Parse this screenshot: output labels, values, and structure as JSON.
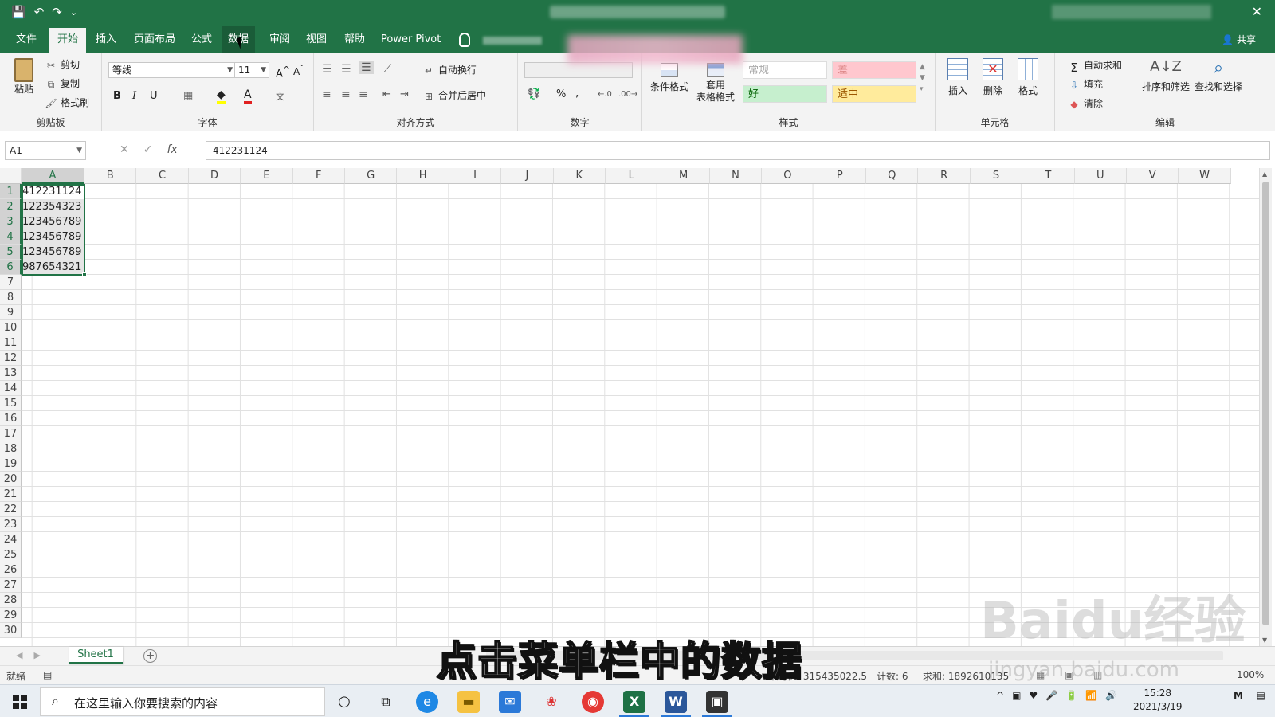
{
  "app": {
    "qat": [
      "💾",
      "↶",
      "↷",
      "⌄"
    ],
    "close_icon": "✕"
  },
  "menu": {
    "tabs": [
      "文件",
      "开始",
      "插入",
      "页面布局",
      "公式",
      "数据",
      "审阅",
      "视图",
      "帮助",
      "Power Pivot"
    ],
    "share": "共享"
  },
  "ribbon": {
    "clipboard": {
      "label": "剪贴板",
      "paste": "粘贴",
      "cut": "剪切",
      "copy": "复制",
      "format_painter": "格式刷"
    },
    "font": {
      "label": "字体",
      "font_name": "等线",
      "font_size": "11"
    },
    "alignment": {
      "label": "对齐方式",
      "wrap": "自动换行",
      "merge": "合并后居中"
    },
    "number": {
      "label": "数字",
      "percent": "%",
      "comma": ","
    },
    "styles": {
      "label": "样式",
      "conditional": "条件格式",
      "table_l1": "套用",
      "table_l2": "表格格式",
      "normal": "常规",
      "bad": "差",
      "good": "好",
      "neutral": "适中"
    },
    "cells": {
      "label": "单元格",
      "insert": "插入",
      "delete": "删除",
      "format": "格式"
    },
    "editing": {
      "label": "编辑",
      "autosum": "自动求和",
      "fill": "填充",
      "clear": "清除",
      "sort_filter": "排序和筛选",
      "find_select": "查找和选择"
    }
  },
  "formula_bar": {
    "name_box": "A1",
    "fx": "fx",
    "value": "412231124"
  },
  "grid": {
    "columns": [
      "A",
      "B",
      "C",
      "D",
      "E",
      "F",
      "G",
      "H",
      "I",
      "J",
      "K",
      "L",
      "M",
      "N",
      "O",
      "P",
      "Q",
      "R",
      "S",
      "T",
      "U",
      "V",
      "W"
    ],
    "rows": [
      "1",
      "2",
      "3",
      "4",
      "5",
      "6",
      "7",
      "8",
      "9",
      "10",
      "11",
      "12",
      "13",
      "14",
      "15",
      "16",
      "17",
      "18",
      "19",
      "20",
      "21",
      "22",
      "23",
      "24",
      "25",
      "26",
      "27",
      "28",
      "29",
      "30"
    ],
    "cells_A": [
      "412231124",
      "122354323",
      "123456789",
      "123456789",
      "123456789",
      "987654321"
    ]
  },
  "sheets": {
    "active": "Sheet1",
    "add": "+"
  },
  "status": {
    "ready": "就绪",
    "average": "平均值: 315435022.5",
    "count": "计数: 6",
    "sum": "求和: 1892610135",
    "zoom": "100%"
  },
  "taskbar": {
    "search_placeholder": "在这里输入你要搜索的内容",
    "time": "15:28",
    "date": "2021/3/19"
  },
  "overlay": {
    "subtitle": "点击菜单栏中的数据",
    "watermark": "Baidu经验",
    "watermark_sub": "jingyan.baidu.com"
  }
}
